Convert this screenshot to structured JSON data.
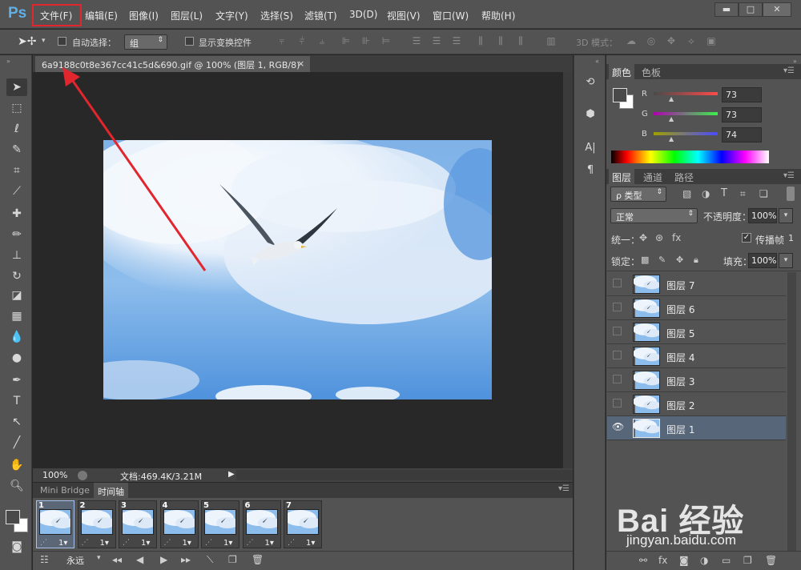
{
  "app": {
    "logo": "Ps"
  },
  "menu": [
    "文件(F)",
    "编辑(E)",
    "图像(I)",
    "图层(L)",
    "文字(Y)",
    "选择(S)",
    "滤镜(T)",
    "3D(D)",
    "视图(V)",
    "窗口(W)",
    "帮助(H)"
  ],
  "window_controls": {
    "minimize": "▬",
    "maximize": "□",
    "close": "✕"
  },
  "options": {
    "auto_select_label": "自动选择：",
    "auto_select_value": "组",
    "show_transform_label": "显示变换控件",
    "mode_3d_label": "3D 模式："
  },
  "document": {
    "tab_title": "6a9188c0t8e367cc41c5d&690.gif @ 100% (图层 1, RGB/8)",
    "close": "×",
    "zoom": "100%",
    "doc_size": "文档:469.4K/3.21M"
  },
  "timeline": {
    "tabs": [
      "Mini Bridge",
      "时间轴"
    ],
    "frames": [
      {
        "num": "1",
        "delay": "1▾"
      },
      {
        "num": "2",
        "delay": "1▾"
      },
      {
        "num": "3",
        "delay": "1▾"
      },
      {
        "num": "4",
        "delay": "1▾"
      },
      {
        "num": "5",
        "delay": "1▾"
      },
      {
        "num": "6",
        "delay": "1▾"
      },
      {
        "num": "7",
        "delay": "1▾"
      }
    ],
    "loop": "永远"
  },
  "color_panel": {
    "tabs": [
      "颜色",
      "色板"
    ],
    "r_label": "R",
    "g_label": "G",
    "b_label": "B",
    "r": "73",
    "g": "73",
    "b": "74"
  },
  "layers_panel": {
    "tabs": [
      "图层",
      "通道",
      "路径"
    ],
    "filter_kind": "类型",
    "blend_mode": "正常",
    "opacity_label": "不透明度：",
    "opacity": "100%",
    "unify_label": "统一：",
    "propagate_label": "传播帧",
    "propagate_value": "1",
    "lock_label": "锁定：",
    "fill_label": "填充：",
    "fill": "100%",
    "layers": [
      {
        "name": "图层 7",
        "visible": false,
        "selected": false
      },
      {
        "name": "图层 6",
        "visible": false,
        "selected": false
      },
      {
        "name": "图层 5",
        "visible": false,
        "selected": false
      },
      {
        "name": "图层 4",
        "visible": false,
        "selected": false
      },
      {
        "name": "图层 3",
        "visible": false,
        "selected": false
      },
      {
        "name": "图层 2",
        "visible": false,
        "selected": false
      },
      {
        "name": "图层 1",
        "visible": true,
        "selected": true
      }
    ]
  },
  "watermark": {
    "text": "Bai 经验",
    "url": "jingyan.baidu.com"
  },
  "colors": {
    "highlight_red": "#e2262e",
    "ps_blue": "#5fb0e8",
    "selected_row": "#58667a"
  }
}
